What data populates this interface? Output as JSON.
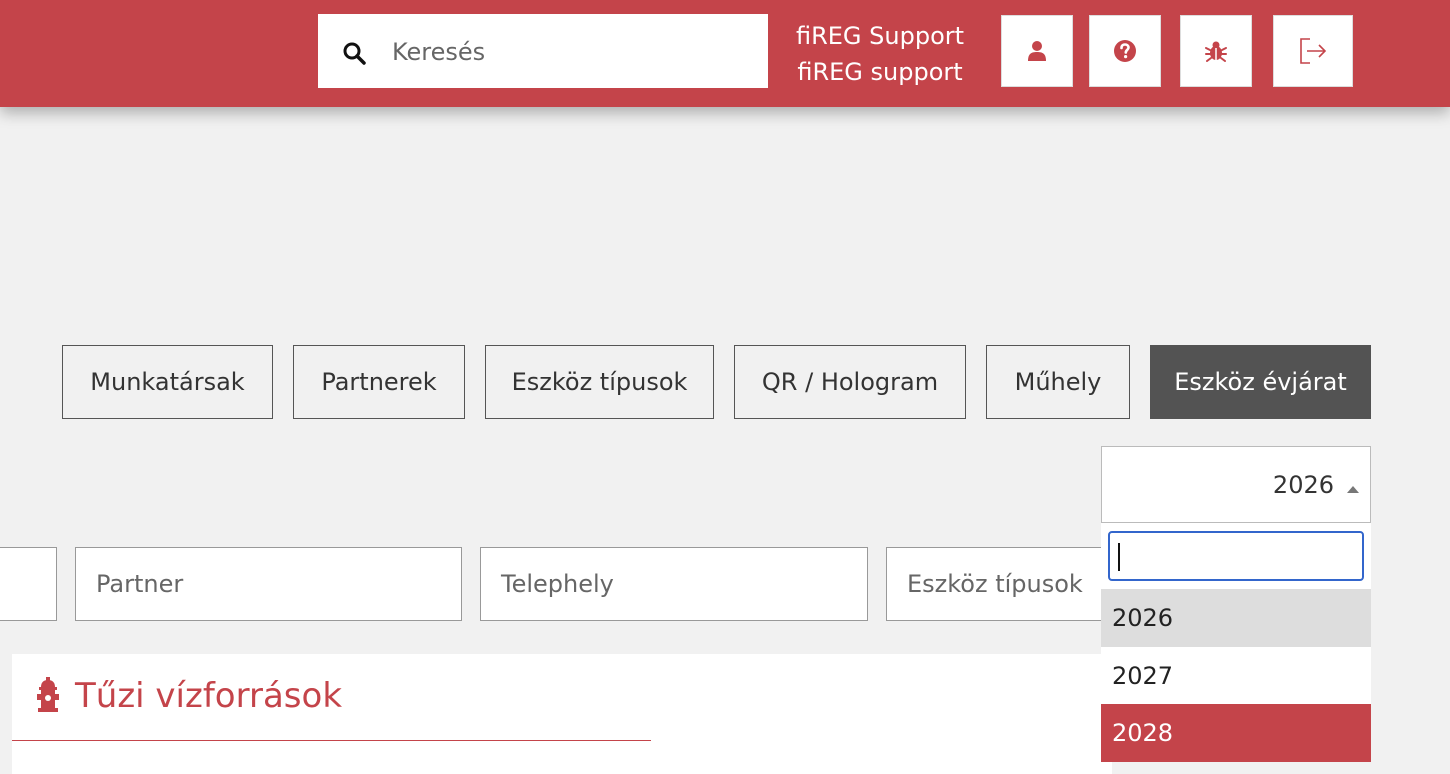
{
  "header": {
    "search_placeholder": "Keresés",
    "user_name": "fiREG Support",
    "user_role": "fiREG support",
    "buttons": [
      "profile",
      "help",
      "bug-report",
      "logout"
    ]
  },
  "tabs": [
    {
      "label": "Munkatársak",
      "active": false
    },
    {
      "label": "Partnerek",
      "active": false
    },
    {
      "label": "Eszköz típusok",
      "active": false
    },
    {
      "label": "QR / Hologram",
      "active": false
    },
    {
      "label": "Műhely",
      "active": false
    },
    {
      "label": "Eszköz évjárat",
      "active": true
    }
  ],
  "year_select": {
    "selected": "2026",
    "search_value": "",
    "options": [
      "2026",
      "2027",
      "2028"
    ],
    "highlighted": "2028"
  },
  "filters": [
    {
      "placeholder": ""
    },
    {
      "placeholder": "Partner"
    },
    {
      "placeholder": "Telephely"
    },
    {
      "placeholder": "Eszköz típusok"
    }
  ],
  "section": {
    "title": "Tűzi vízforrások",
    "icon": "fire-hydrant-icon"
  },
  "colors": {
    "brand": "#c4444a",
    "active_tab": "#535353",
    "focus": "#3366cc"
  }
}
